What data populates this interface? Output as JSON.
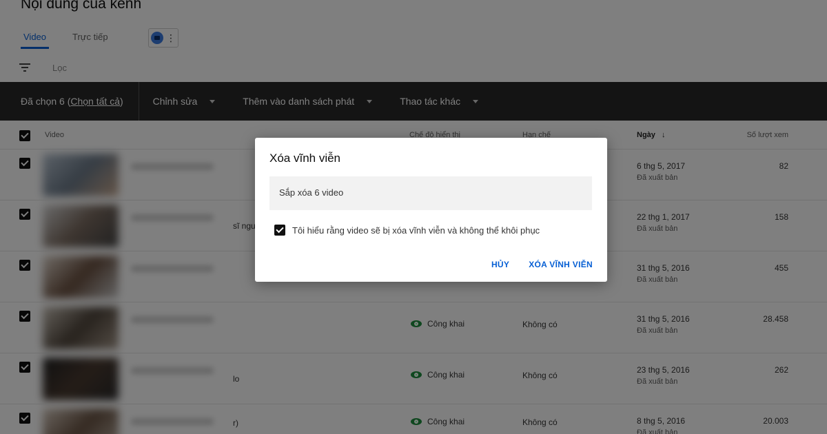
{
  "page": {
    "title": "Nội dung của kênh"
  },
  "tabs": [
    {
      "label": "Video",
      "active": true
    },
    {
      "label": "Trực tiếp",
      "active": false
    }
  ],
  "filter": {
    "label": "Lọc"
  },
  "action_bar": {
    "selected_prefix": "Đã chọn 6 (",
    "select_all": "Chọn tất cả",
    "selected_suffix": ")",
    "edit": "Chỉnh sửa",
    "add_to_playlist": "Thêm vào danh sách phát",
    "more_actions": "Thao tác khác"
  },
  "table": {
    "headers": {
      "video": "Video",
      "visibility": "Chế độ hiển thị",
      "restrictions": "Hạn chế",
      "date": "Ngày",
      "views": "Số lượt xem"
    },
    "rows": [
      {
        "title_tail": "",
        "visibility": "",
        "restrictions": "",
        "date": "6 thg 5, 2017",
        "status": "Đã xuất bản",
        "views": "82"
      },
      {
        "title_tail": "sĩ ngư",
        "visibility": "",
        "restrictions": "",
        "date": "22 thg 1, 2017",
        "status": "Đã xuất bản",
        "views": "158"
      },
      {
        "title_tail": "",
        "visibility": "",
        "restrictions": "",
        "date": "31 thg 5, 2016",
        "status": "Đã xuất bản",
        "views": "455"
      },
      {
        "title_tail": "",
        "visibility": "Công khai",
        "restrictions": "Không có",
        "date": "31 thg 5, 2016",
        "status": "Đã xuất bản",
        "views": "28.458"
      },
      {
        "title_tail": "lo",
        "visibility": "Công khai",
        "restrictions": "Không có",
        "date": "23 thg 5, 2016",
        "status": "Đã xuất bản",
        "views": "262"
      },
      {
        "title_tail": "r)",
        "visibility": "Công khai",
        "restrictions": "Không có",
        "date": "8 thg 5, 2016",
        "status": "Đã xuất bản",
        "views": "20.003"
      }
    ]
  },
  "dialog": {
    "title": "Xóa vĩnh viễn",
    "info": "Sắp xóa 6 video",
    "confirm_label": "Tôi hiểu rằng video sẽ bị xóa vĩnh viễn và không thể khôi phục",
    "cancel": "HỦY",
    "delete": "XÓA VĨNH VIỄN"
  },
  "colors": {
    "accent": "#065fd4",
    "action_bar": "#282828",
    "public_icon": "#1e8e3e"
  }
}
